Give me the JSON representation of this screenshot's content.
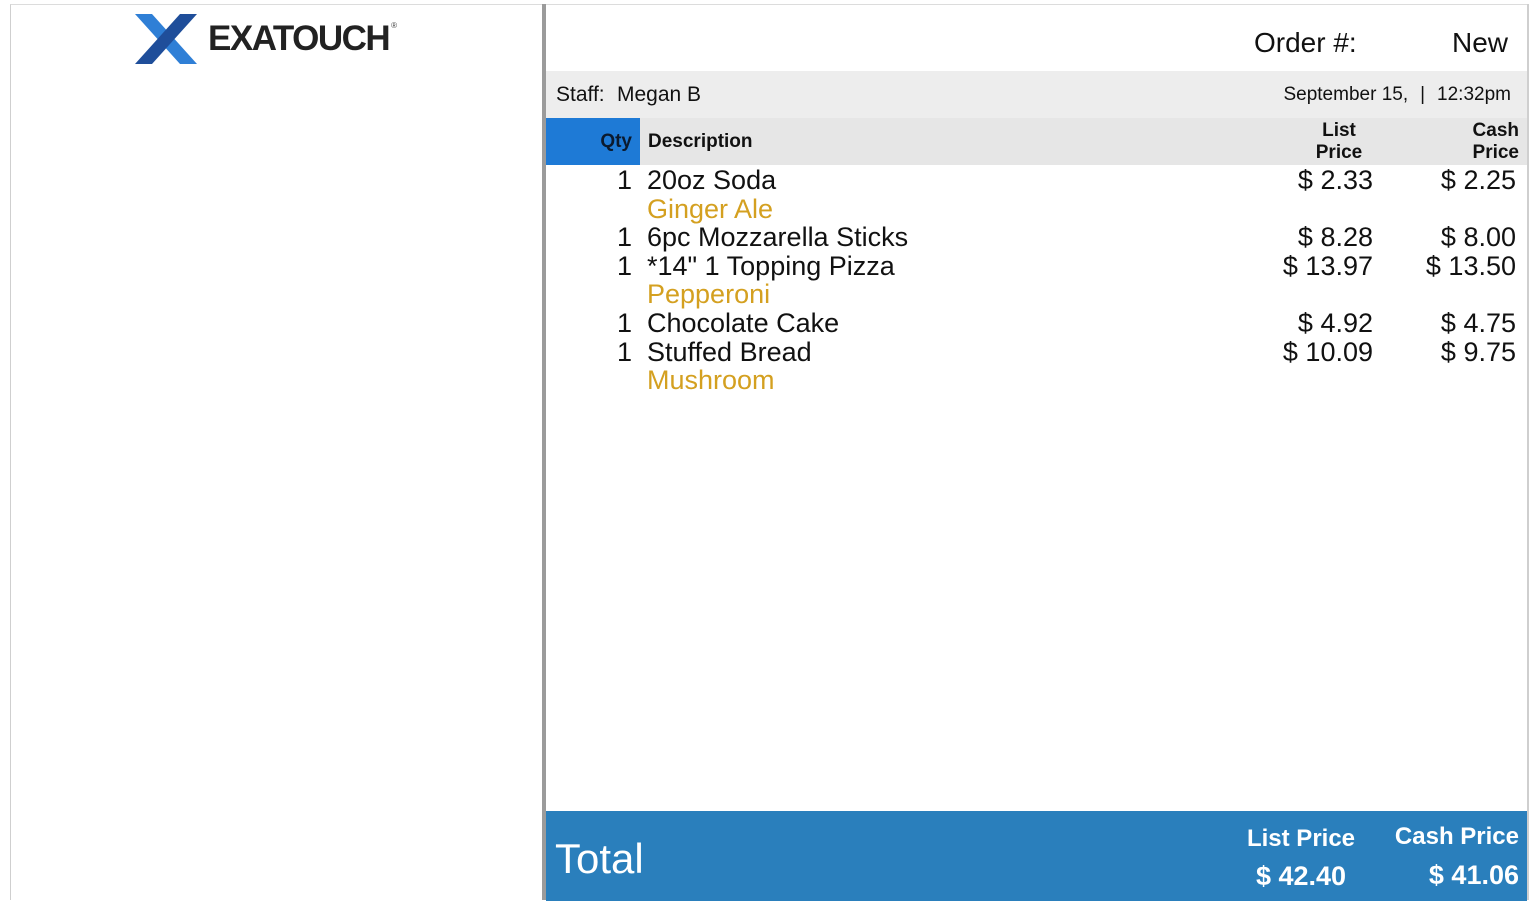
{
  "brand": {
    "name": "EXATOUCH",
    "registered_mark": "®",
    "colors": {
      "x_dark": "#1f4e9a",
      "x_light": "#2f7fd6"
    }
  },
  "order": {
    "label": "Order #:",
    "value": "New"
  },
  "staff": {
    "label": "Staff:",
    "name": "Megan B"
  },
  "datetime": {
    "date": "September 15,",
    "separator": "|",
    "time": "12:32pm"
  },
  "columns": {
    "qty": "Qty",
    "description": "Description",
    "list_price_line1": "List",
    "list_price_line2": "Price",
    "cash_price_line1": "Cash",
    "cash_price_line2": "Price"
  },
  "items": [
    {
      "qty": "1",
      "description": "20oz Soda",
      "list_price": "$ 2.33",
      "cash_price": "$ 2.25"
    },
    {
      "qty": "",
      "description": "Ginger Ale",
      "list_price": "",
      "cash_price": "",
      "modifier": true
    },
    {
      "qty": "1",
      "description": "6pc Mozzarella Sticks",
      "list_price": "$ 8.28",
      "cash_price": "$ 8.00"
    },
    {
      "qty": "1",
      "description": "*14\" 1 Topping Pizza",
      "list_price": "$ 13.97",
      "cash_price": "$ 13.50"
    },
    {
      "qty": "",
      "description": "Pepperoni",
      "list_price": "",
      "cash_price": "",
      "modifier": true
    },
    {
      "qty": "1",
      "description": "Chocolate Cake",
      "list_price": "$ 4.92",
      "cash_price": "$ 4.75"
    },
    {
      "qty": "1",
      "description": "Stuffed Bread",
      "list_price": "$ 10.09",
      "cash_price": "$ 9.75"
    },
    {
      "qty": "",
      "description": "Mushroom",
      "list_price": "",
      "cash_price": "",
      "modifier": true
    }
  ],
  "total": {
    "label": "Total",
    "list_price_label": "List Price",
    "list_price_value": "$ 42.40",
    "cash_price_label": "Cash Price",
    "cash_price_value": "$ 41.06"
  },
  "colors": {
    "qty_header": "#1e7ad6",
    "modifier_text": "#d4a020",
    "total_bar": "#2a7fbc",
    "staff_bar": "#ededed",
    "header_row": "#e6e6e6"
  }
}
